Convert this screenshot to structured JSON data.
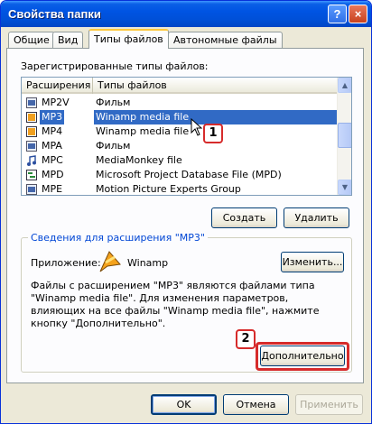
{
  "window": {
    "title": "Свойства папки",
    "help_label": "?",
    "close_label": "×"
  },
  "tabs": [
    {
      "label": "Общие",
      "active": false
    },
    {
      "label": "Вид",
      "active": false
    },
    {
      "label": "Типы файлов",
      "active": true
    },
    {
      "label": "Автономные файлы",
      "active": false
    }
  ],
  "registered_label": "Зарегистрированные типы файлов:",
  "list": {
    "columns": [
      "Расширения",
      "Типы файлов"
    ],
    "rows": [
      {
        "ext": "MP2V",
        "type": "Фильм",
        "icon": "video-file-icon",
        "selected": false
      },
      {
        "ext": "MP3",
        "type": "Winamp media file",
        "icon": "winamp-file-icon",
        "selected": true
      },
      {
        "ext": "MP4",
        "type": "Winamp media file",
        "icon": "winamp-file-icon",
        "selected": false
      },
      {
        "ext": "MPA",
        "type": "Фильм",
        "icon": "video-file-icon",
        "selected": false
      },
      {
        "ext": "MPC",
        "type": "MediaMonkey file",
        "icon": "music-note-icon",
        "selected": false
      },
      {
        "ext": "MPD",
        "type": "Microsoft Project Database File (MPD)",
        "icon": "project-file-icon",
        "selected": false
      },
      {
        "ext": "MPE",
        "type": "Motion Picture Experts Group",
        "icon": "video-file-icon",
        "selected": false
      }
    ]
  },
  "buttons": {
    "create": "Создать",
    "delete": "Удалить",
    "change": "Изменить...",
    "advanced": "Дополнительно",
    "ok": "OK",
    "cancel": "Отмена",
    "apply": "Применить"
  },
  "details": {
    "group_title": "Сведения для расширения \"MP3\"",
    "app_label": "Приложение:",
    "app_name": "Winamp",
    "description": "Файлы с расширением \"MP3\" являются файлами типа \"Winamp media file\". Для изменения параметров, влияющих на все файлы \"Winamp media file\", нажмите кнопку \"Дополнительно\"."
  },
  "callouts": [
    "1",
    "2"
  ],
  "colors": {
    "selection": "#316ac5",
    "callout_red": "#d62b2b",
    "group_title": "#0046d5"
  }
}
